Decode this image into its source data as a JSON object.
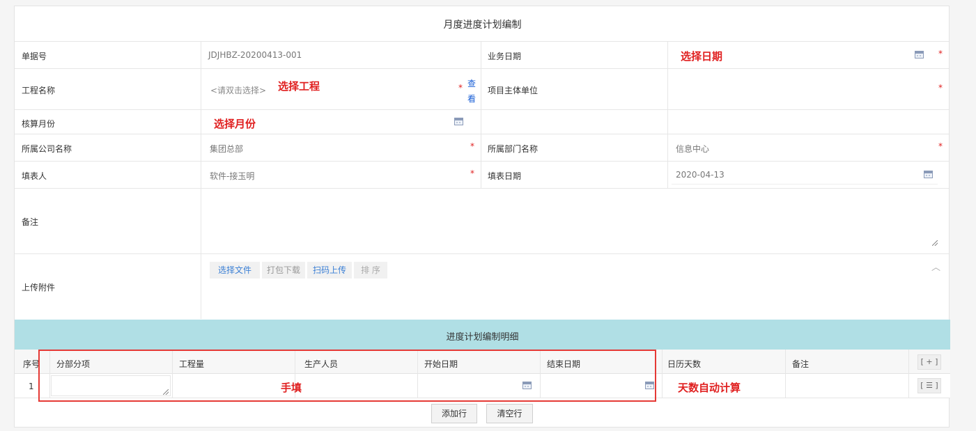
{
  "form": {
    "title": "月度进度计划编制",
    "fields": {
      "doc_no_label": "单据号",
      "doc_no_value": "JDJHBZ-20200413-001",
      "biz_date_label": "业务日期",
      "biz_date_annotation": "选择日期",
      "project_name_label": "工程名称",
      "project_name_placeholder": "<请双击选择>",
      "project_name_annotation": "选择工程",
      "view_link_1": "查",
      "view_link_2": "看",
      "project_owner_label": "项目主体单位",
      "account_month_label": "核算月份",
      "account_month_annotation": "选择月份",
      "company_label": "所属公司名称",
      "company_value": "集团总部",
      "department_label": "所属部门名称",
      "department_value": "信息中心",
      "filler_label": "填表人",
      "filler_value": "软件-接玉明",
      "fill_date_label": "填表日期",
      "fill_date_value": "2020-04-13",
      "remark_label": "备注",
      "attachment_label": "上传附件",
      "required_mark": "*"
    },
    "attachment_buttons": {
      "choose_file": "选择文件",
      "pack_download": "打包下载",
      "scan_upload": "扫码上传",
      "sort": "排 序"
    }
  },
  "detail": {
    "title": "进度计划编制明细",
    "columns": [
      "序号",
      "分部分项",
      "工程量",
      "生产人员",
      "开始日期",
      "结束日期",
      "日历天数",
      "备注"
    ],
    "add_col_btn": "[ + ]",
    "row_menu_btn": "[ ☰ ]",
    "rows": [
      {
        "index": "1"
      }
    ],
    "manual_fill_annotation": "手填",
    "auto_days_annotation": "天数自动计算",
    "add_row_button": "添加行",
    "clear_rows_button": "清空行"
  },
  "colors": {
    "header_band": "#b0dfe5",
    "required": "#e02020",
    "annotation": "#e02020",
    "link": "#1a5fd6"
  }
}
